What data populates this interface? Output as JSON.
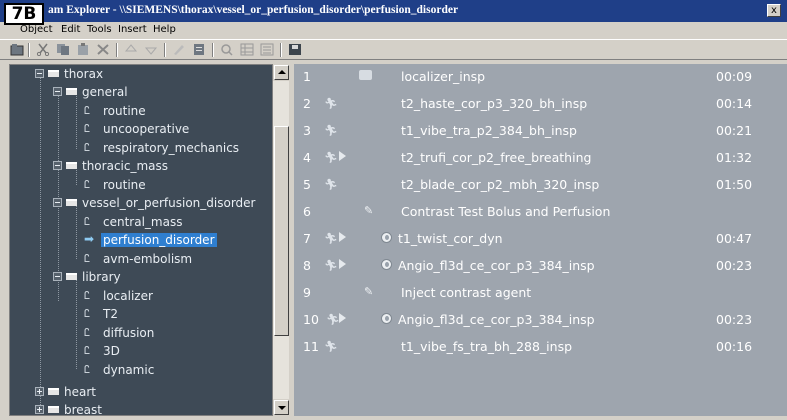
{
  "badge": "7B",
  "window": {
    "title": "am Explorer - \\\\SIEMENS\\thorax\\vessel_or_perfusion_disorder\\perfusion_disorder",
    "close_label": "x"
  },
  "menu": [
    "Object",
    "Edit",
    "Tools",
    "Insert",
    "Help"
  ],
  "tree": [
    {
      "label": "thorax",
      "type": "folder",
      "state": "expanded"
    },
    {
      "label": "general",
      "type": "folder",
      "state": "expanded"
    },
    {
      "label": "routine",
      "type": "protocol"
    },
    {
      "label": "uncooperative",
      "type": "protocol"
    },
    {
      "label": "respiratory_mechanics",
      "type": "protocol"
    },
    {
      "label": "thoracic_mass",
      "type": "folder",
      "state": "expanded"
    },
    {
      "label": "routine",
      "type": "protocol"
    },
    {
      "label": "vessel_or_perfusion_disorder",
      "type": "folder",
      "state": "expanded"
    },
    {
      "label": "central_mass",
      "type": "protocol"
    },
    {
      "label": "perfusion_disorder",
      "type": "protocol",
      "selected": true
    },
    {
      "label": "avm-embolism",
      "type": "protocol"
    },
    {
      "label": "library",
      "type": "folder",
      "state": "expanded"
    },
    {
      "label": "localizer",
      "type": "protocol"
    },
    {
      "label": "T2",
      "type": "protocol"
    },
    {
      "label": "diffusion",
      "type": "protocol"
    },
    {
      "label": "3D",
      "type": "protocol"
    },
    {
      "label": "dynamic",
      "type": "protocol"
    },
    {
      "label": "heart",
      "type": "folder",
      "state": "collapsed"
    },
    {
      "label": "breast",
      "type": "folder",
      "state": "collapsed"
    }
  ],
  "steps": [
    {
      "num": "1",
      "name": "localizer_insp",
      "time": "00:09",
      "icons": [
        "localizer-icon"
      ]
    },
    {
      "num": "2",
      "name": "t2_haste_cor_p3_320_bh_insp",
      "time": "00:14",
      "icons": [
        "running-man-icon"
      ]
    },
    {
      "num": "3",
      "name": "t1_vibe_tra_p2_384_bh_insp",
      "time": "00:21",
      "icons": [
        "running-man-icon"
      ]
    },
    {
      "num": "4",
      "name": "t2_trufi_cor_p2_free_breathing",
      "time": "01:32",
      "icons": [
        "running-man-icon",
        "play-icon"
      ]
    },
    {
      "num": "5",
      "name": "t2_blade_cor_p2_mbh_320_insp",
      "time": "01:50",
      "icons": [
        "running-man-icon"
      ]
    },
    {
      "num": "6",
      "name": "Contrast Test Bolus and Perfusion",
      "time": "",
      "icons": [
        "pencil-icon"
      ]
    },
    {
      "num": "7",
      "name": "t1_twist_cor_dyn",
      "time": "00:47",
      "icons": [
        "running-man-icon",
        "play-icon",
        "contrast-agent-icon"
      ]
    },
    {
      "num": "8",
      "name": "Angio_fl3d_ce_cor_p3_384_insp",
      "time": "00:23",
      "icons": [
        "running-man-icon",
        "play-icon",
        "contrast-agent-icon"
      ]
    },
    {
      "num": "9",
      "name": "Inject contrast agent",
      "time": "",
      "icons": [
        "pencil-icon"
      ]
    },
    {
      "num": "10",
      "name": "Angio_fl3d_ce_cor_p3_384_insp",
      "time": "00:23",
      "icons": [
        "running-man-icon",
        "play-icon",
        "contrast-agent-icon"
      ]
    },
    {
      "num": "11",
      "name": "t1_vibe_fs_tra_bh_288_insp",
      "time": "00:16",
      "icons": [
        "running-man-icon"
      ]
    }
  ],
  "colors": {
    "titlebar": "#1f3f88",
    "tree_bg": "#3e4a56",
    "list_bg": "#9ea5ae",
    "selection": "#2f7fd0"
  }
}
